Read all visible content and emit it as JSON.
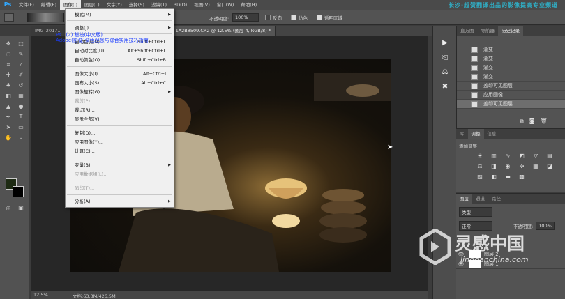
{
  "app": {
    "logo": "Ps",
    "promo": "长沙·超赞翻译出品的影像提高专业频道"
  },
  "menubar": [
    {
      "label": "文件(F)"
    },
    {
      "label": "编辑(E)"
    },
    {
      "label": "图像(I)"
    },
    {
      "label": "图层(L)"
    },
    {
      "label": "文字(Y)"
    },
    {
      "label": "选择(S)"
    },
    {
      "label": "滤镜(T)"
    },
    {
      "label": "3D(D)"
    },
    {
      "label": "视图(V)"
    },
    {
      "label": "窗口(W)"
    },
    {
      "label": "帮助(H)"
    }
  ],
  "options": {
    "opacity_label": "不透明度:",
    "opacity_value": "100%",
    "reverse_label": "反向",
    "dither_label": "仿色",
    "transparency_label": "透明区域"
  },
  "tabs": [
    {
      "label": "IMG_2017..."
    },
    {
      "label": "1A2B8509.CR2 @ 12.5% (图层 4, RGB/8) *"
    }
  ],
  "overlay_caption": {
    "line1": "Ps...(2) 秘技(中文版)",
    "line2": "Adobe(影像)调色理念与综合实用技巧指南"
  },
  "image_menu": {
    "items": [
      {
        "label": "模式(M)",
        "shortcut": "",
        "submenu": true,
        "disabled": false
      },
      {
        "label": "调整(J)",
        "shortcut": "",
        "submenu": true,
        "disabled": false
      },
      {
        "label": "自动色调(N)",
        "shortcut": "Shift+Ctrl+L",
        "submenu": false,
        "disabled": false
      },
      {
        "label": "自动对比度(U)",
        "shortcut": "Alt+Shift+Ctrl+L",
        "submenu": false,
        "disabled": false
      },
      {
        "label": "自动颜色(O)",
        "shortcut": "Shift+Ctrl+B",
        "submenu": false,
        "disabled": false
      },
      {
        "label": "图像大小(I)...",
        "shortcut": "Alt+Ctrl+I",
        "submenu": false,
        "disabled": false
      },
      {
        "label": "画布大小(S)...",
        "shortcut": "Alt+Ctrl+C",
        "submenu": false,
        "disabled": false
      },
      {
        "label": "图像旋转(G)",
        "shortcut": "",
        "submenu": true,
        "disabled": false
      },
      {
        "label": "裁剪(P)",
        "shortcut": "",
        "submenu": false,
        "disabled": true
      },
      {
        "label": "裁切(R)...",
        "shortcut": "",
        "submenu": false,
        "disabled": false
      },
      {
        "label": "显示全部(V)",
        "shortcut": "",
        "submenu": false,
        "disabled": false
      },
      {
        "label": "复制(D)...",
        "shortcut": "",
        "submenu": false,
        "disabled": false
      },
      {
        "label": "应用图像(Y)...",
        "shortcut": "",
        "submenu": false,
        "disabled": false
      },
      {
        "label": "计算(C)...",
        "shortcut": "",
        "submenu": false,
        "disabled": false
      },
      {
        "label": "变量(B)",
        "shortcut": "",
        "submenu": true,
        "disabled": false
      },
      {
        "label": "应用数据组(L)...",
        "shortcut": "",
        "submenu": false,
        "disabled": true
      },
      {
        "label": "陷印(T)...",
        "shortcut": "",
        "submenu": false,
        "disabled": true
      },
      {
        "label": "分析(A)",
        "shortcut": "",
        "submenu": true,
        "disabled": false
      }
    ]
  },
  "history_panel": {
    "tabs": [
      "直方图",
      "导航器",
      "历史记录"
    ],
    "items": [
      {
        "label": "渐变",
        "selected": false
      },
      {
        "label": "渐变",
        "selected": false
      },
      {
        "label": "渐变",
        "selected": false
      },
      {
        "label": "渐变",
        "selected": false
      },
      {
        "label": "盖印可见图层",
        "selected": false
      },
      {
        "label": "应用图像",
        "selected": false
      },
      {
        "label": "盖印可见图层",
        "selected": true
      }
    ]
  },
  "adjust_panel": {
    "tabs": [
      "库",
      "调整",
      "信息"
    ],
    "title": "添加调整"
  },
  "layers_panel": {
    "tabs": [
      "图层",
      "通道",
      "路径"
    ],
    "kind_label": "类型",
    "blend_mode": "正常",
    "opacity_label": "不透明度:",
    "opacity_value": "100%",
    "layers": [
      {
        "name": "图层 4"
      },
      {
        "name": "图层 3"
      },
      {
        "name": "图层 2"
      },
      {
        "name": "图层 1"
      }
    ]
  },
  "status": {
    "zoom": "12.5%",
    "doc": "文档:63.3M/426.5M"
  },
  "watermark": {
    "brand": "灵感中国",
    "url": "lingganchina.com"
  },
  "colors": {
    "accent": "#31a8ff",
    "menu_bg": "#f0f0f0",
    "panel_bg": "#535353",
    "caption": "#1a3cff"
  }
}
